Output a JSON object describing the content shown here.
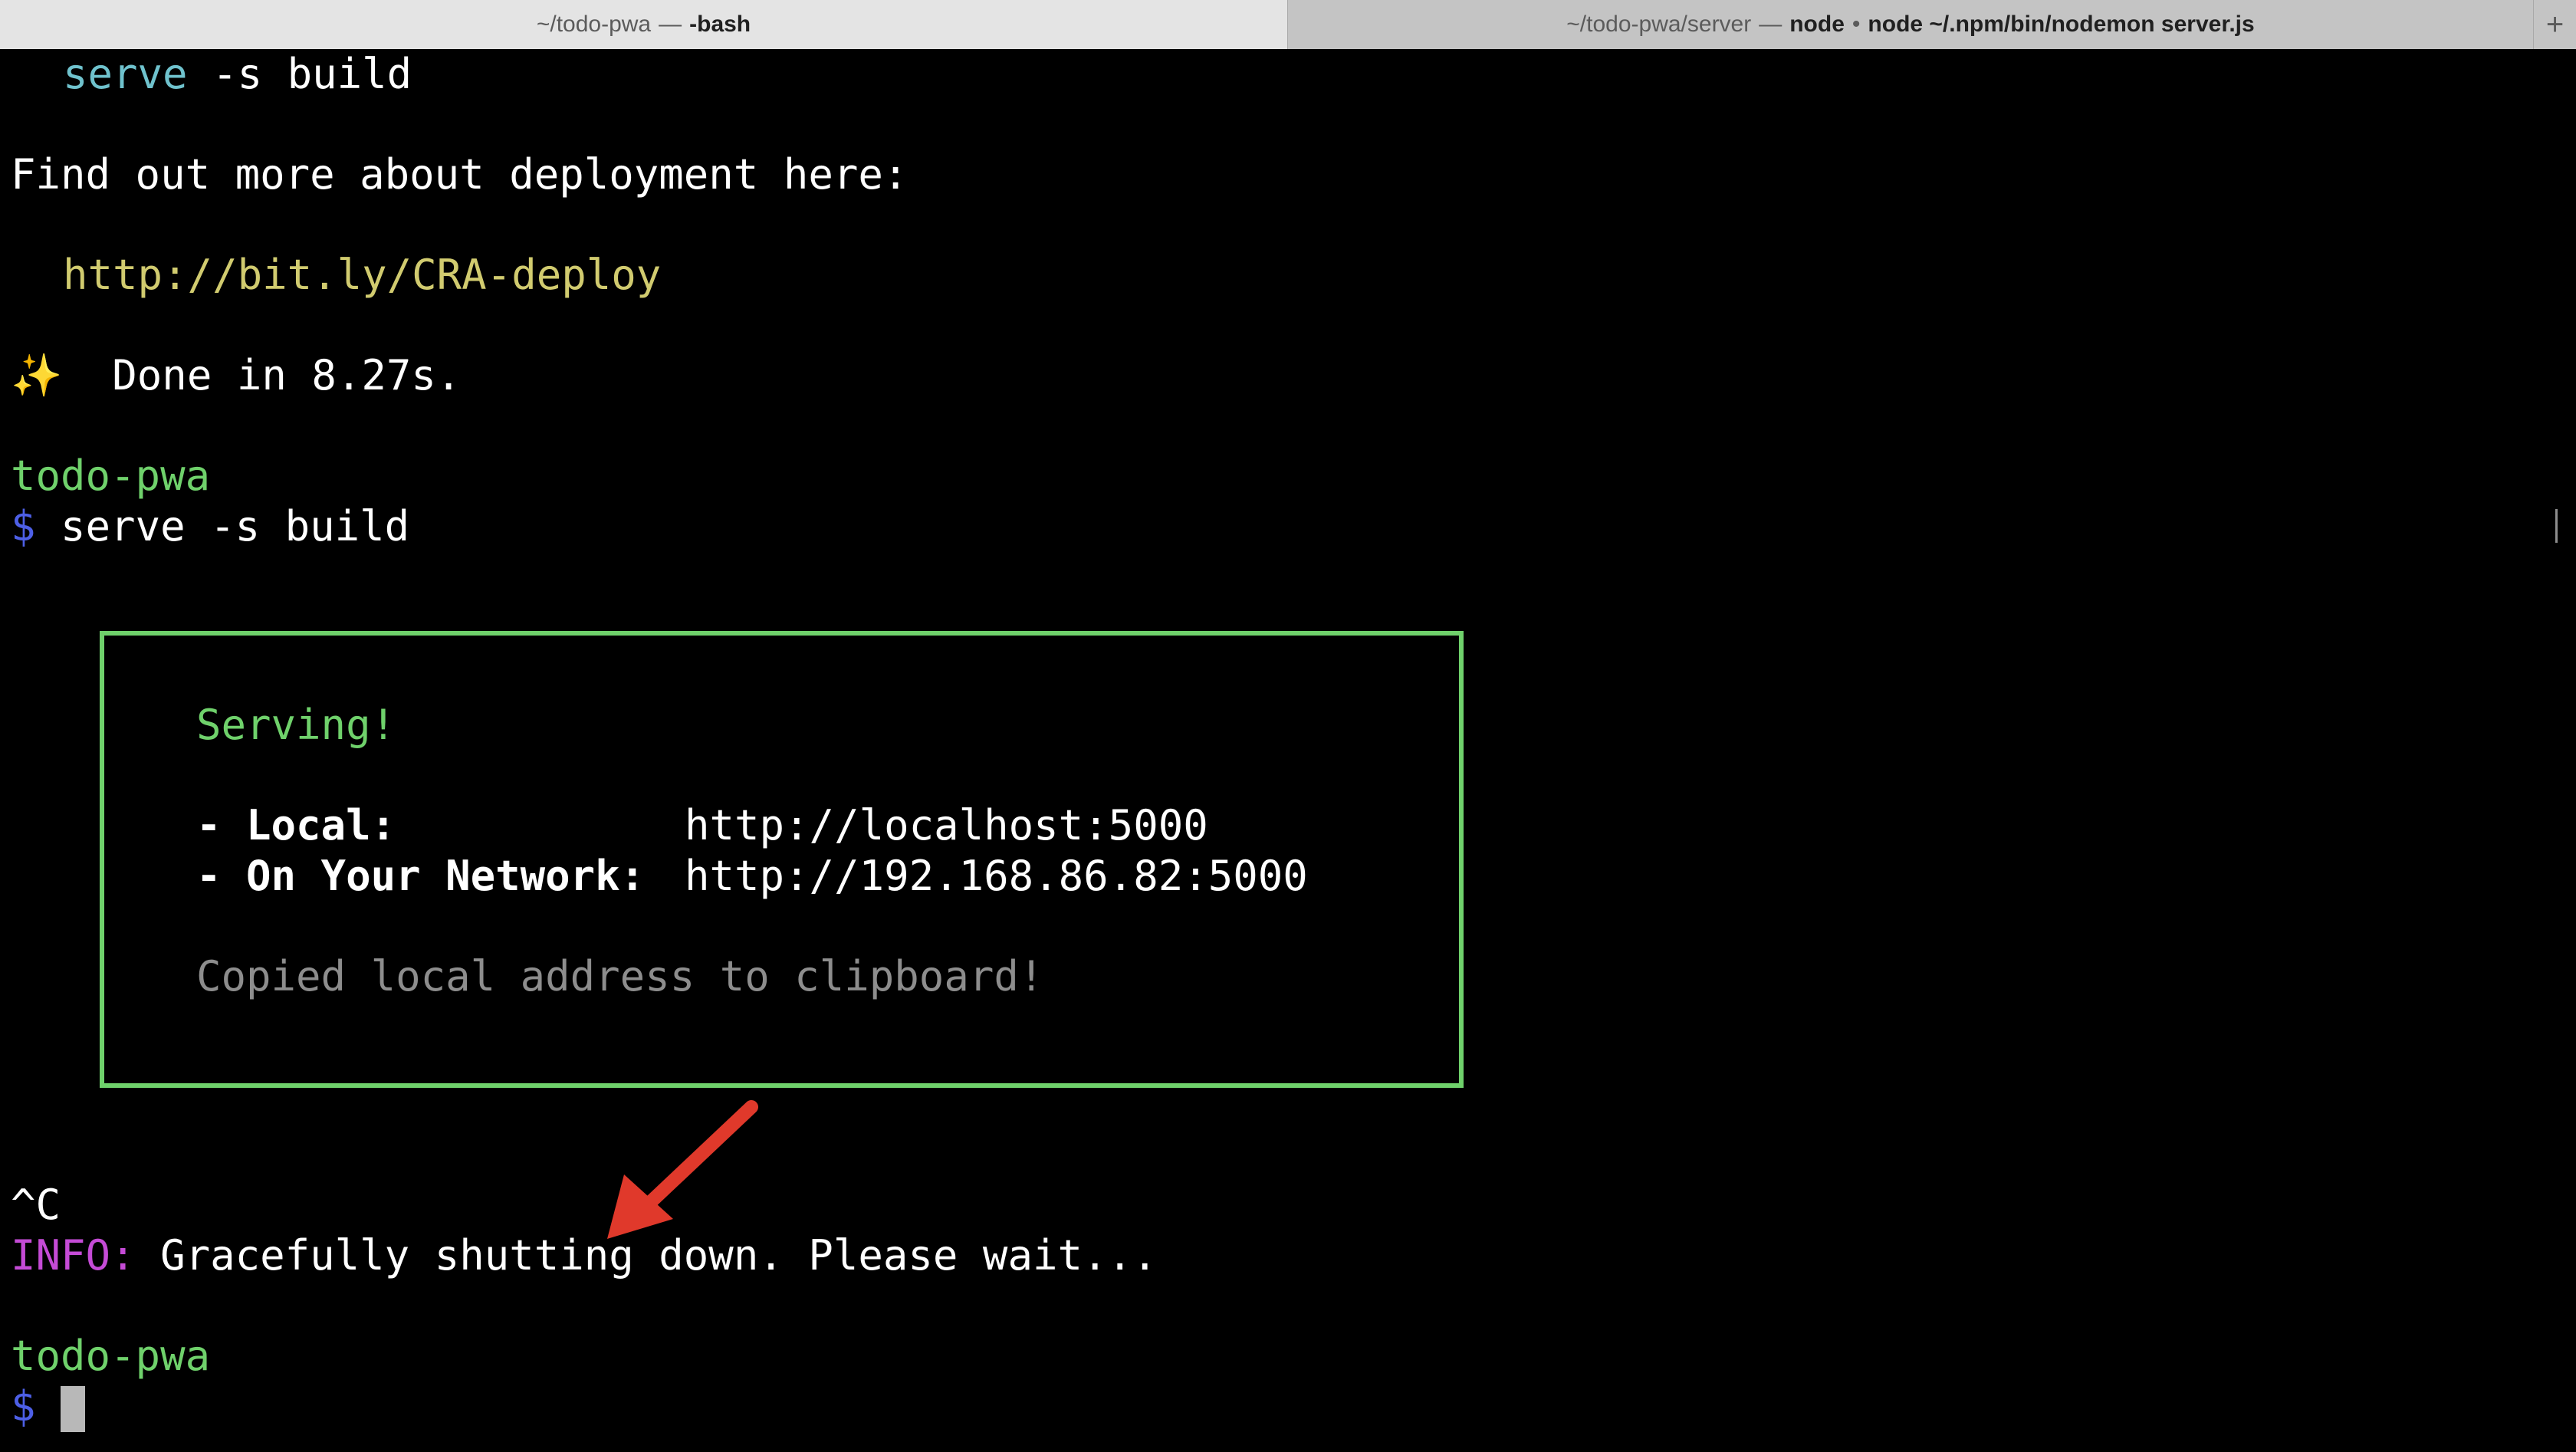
{
  "tabs": {
    "active": {
      "path": "~/todo-pwa",
      "separator": "—",
      "process": "-bash"
    },
    "inactive": {
      "path": "~/todo-pwa/server",
      "separator": "—",
      "process_a": "node",
      "dot": "•",
      "process_b": "node ~/.npm/bin/nodemon server.js"
    },
    "new_tab_label": "+"
  },
  "terminal": {
    "serve_cmd_indent": "serve",
    "serve_cmd_args": " -s build",
    "deploy_text": "Find out more about deployment here:",
    "deploy_url": "http://bit.ly/CRA-deploy",
    "sparkle": "✨",
    "done_text": "Done in 8.27s.",
    "prompt_dir_1": "todo-pwa",
    "prompt_symbol": "$",
    "command_1": "serve -s build",
    "box": {
      "title": "Serving!",
      "local_label": "- Local:",
      "local_url": "http://localhost:5000",
      "network_label": "- On Your Network:",
      "network_url": "http://192.168.86.82:5000",
      "copied_text": "Copied local address to clipboard!"
    },
    "interrupt": "^C",
    "info_label": "INFO:",
    "info_text": " Gracefully shutting down. Please wait...",
    "prompt_dir_2": "todo-pwa"
  },
  "colors": {
    "cyan": "#6fc2cd",
    "yellow": "#d1cb6f",
    "green": "#6fd16b",
    "prompt_blue": "#4d5fe6",
    "magenta": "#c54bd6",
    "arrow_red": "#e0392b"
  }
}
